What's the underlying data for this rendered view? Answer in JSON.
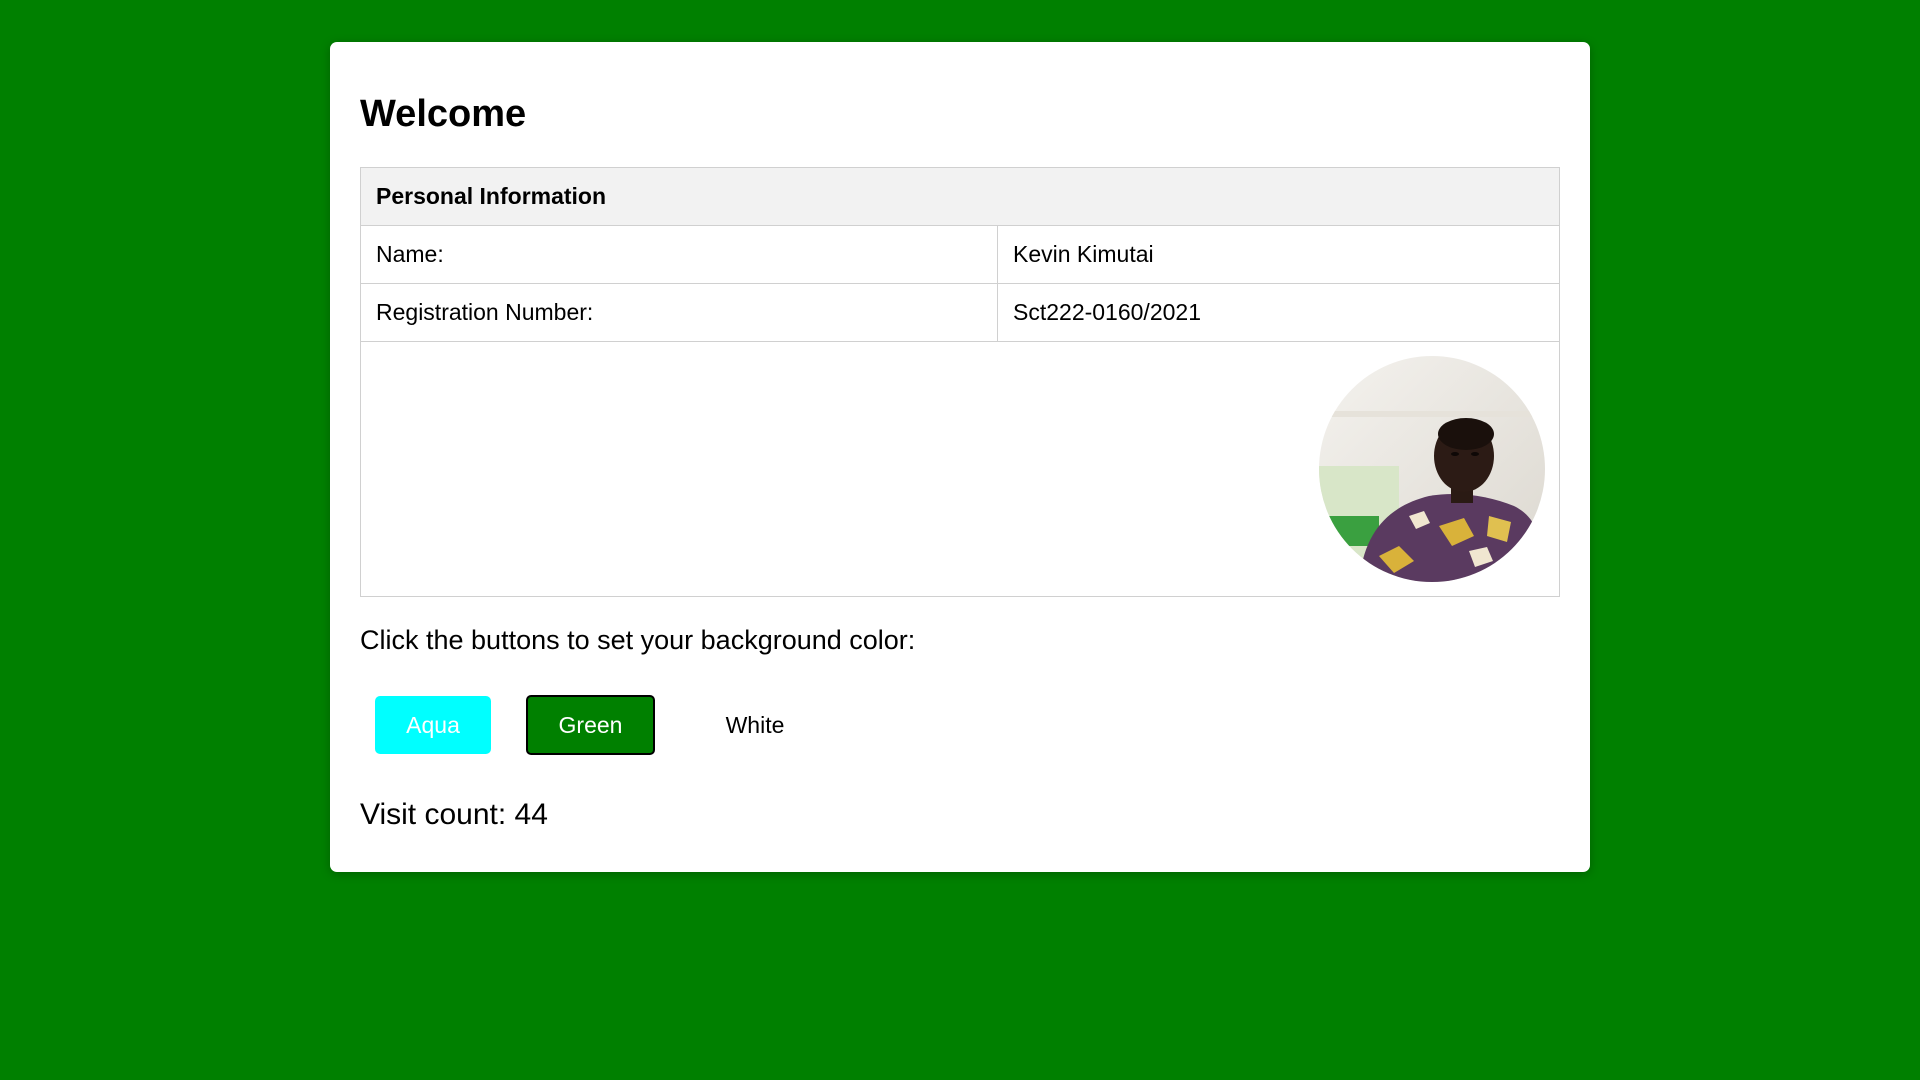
{
  "page": {
    "background_color": "#008000"
  },
  "card": {
    "title": "Welcome",
    "table": {
      "header": "Personal Information",
      "rows": [
        {
          "label": "Name:",
          "value": "Kevin Kimutai"
        },
        {
          "label": "Registration Number:",
          "value": "Sct222-0160/2021"
        }
      ],
      "photo_icon": "person-photo"
    },
    "prompt": "Click the buttons to set your background color:",
    "buttons": [
      {
        "label": "Aqua",
        "color": "#00ffff"
      },
      {
        "label": "Green",
        "color": "#008000"
      },
      {
        "label": "White",
        "color": "#ffffff"
      }
    ],
    "visit_count_text": "Visit count: 44"
  }
}
